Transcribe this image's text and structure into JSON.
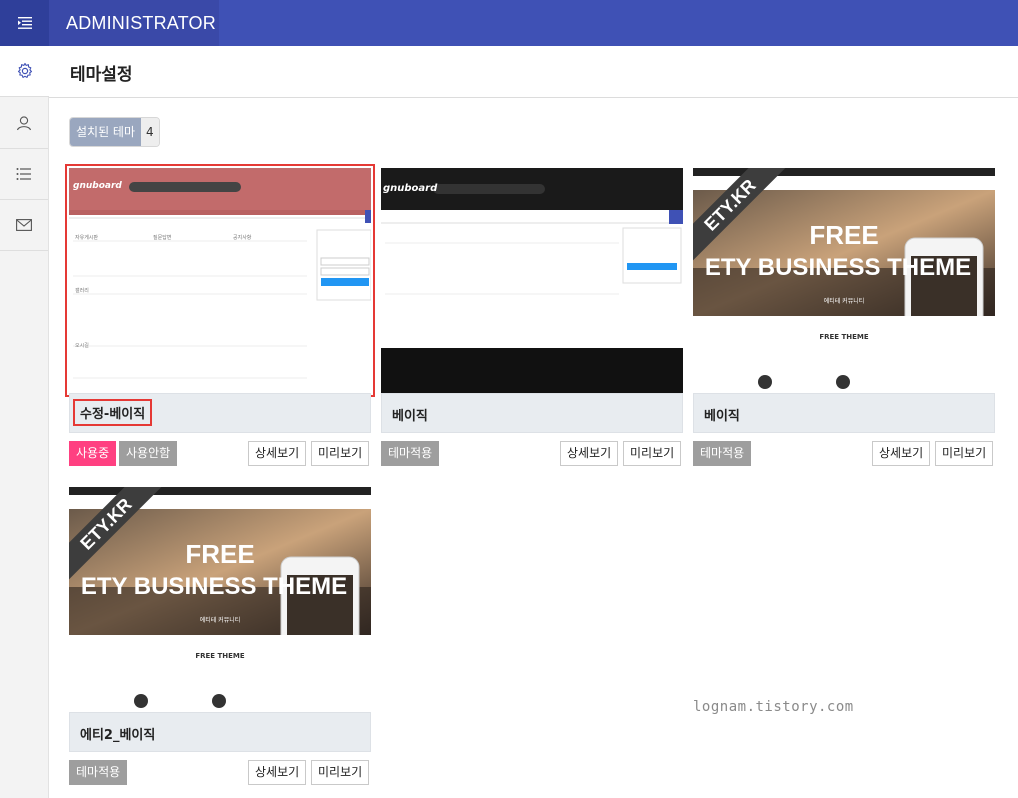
{
  "topbar": {
    "brand": "ADMINISTRATOR"
  },
  "sidebar": {
    "items": [
      {
        "name": "gear"
      },
      {
        "name": "user"
      },
      {
        "name": "list"
      },
      {
        "name": "mail"
      }
    ]
  },
  "page": {
    "title": "테마설정"
  },
  "installed": {
    "label": "설치된 테마",
    "count": "4"
  },
  "themes": [
    {
      "name": "수정-베이직",
      "buttons": {
        "active": "사용중",
        "deactivate": "사용안함",
        "detail": "상세보기",
        "preview": "미리보기"
      }
    },
    {
      "name": "베이직",
      "buttons": {
        "apply": "테마적용",
        "detail": "상세보기",
        "preview": "미리보기"
      }
    },
    {
      "name": "베이직",
      "buttons": {
        "apply": "테마적용",
        "detail": "상세보기",
        "preview": "미리보기"
      }
    },
    {
      "name": "에티2_베이직",
      "buttons": {
        "apply": "테마적용",
        "detail": "상세보기",
        "preview": "미리보기"
      }
    }
  ],
  "previews": {
    "gnuboard_logo": "gnuboard",
    "gnu_boxes": [
      "자유게시판",
      "갤러리",
      "질문답변",
      "공지사항",
      "오시길"
    ],
    "ety_ribbon": "ETY.KR",
    "ety_title1": "FREE",
    "ety_title2": "ETY BUSINESS THEME",
    "ety_free_theme": "FREE THEME",
    "ety_sub": "에티테 커뮤니티"
  },
  "watermark": "lognam.tistory.com",
  "colors": {
    "topbar": "#3f51b5",
    "accent_pink": "#ff4081",
    "selected": "#e53935"
  }
}
